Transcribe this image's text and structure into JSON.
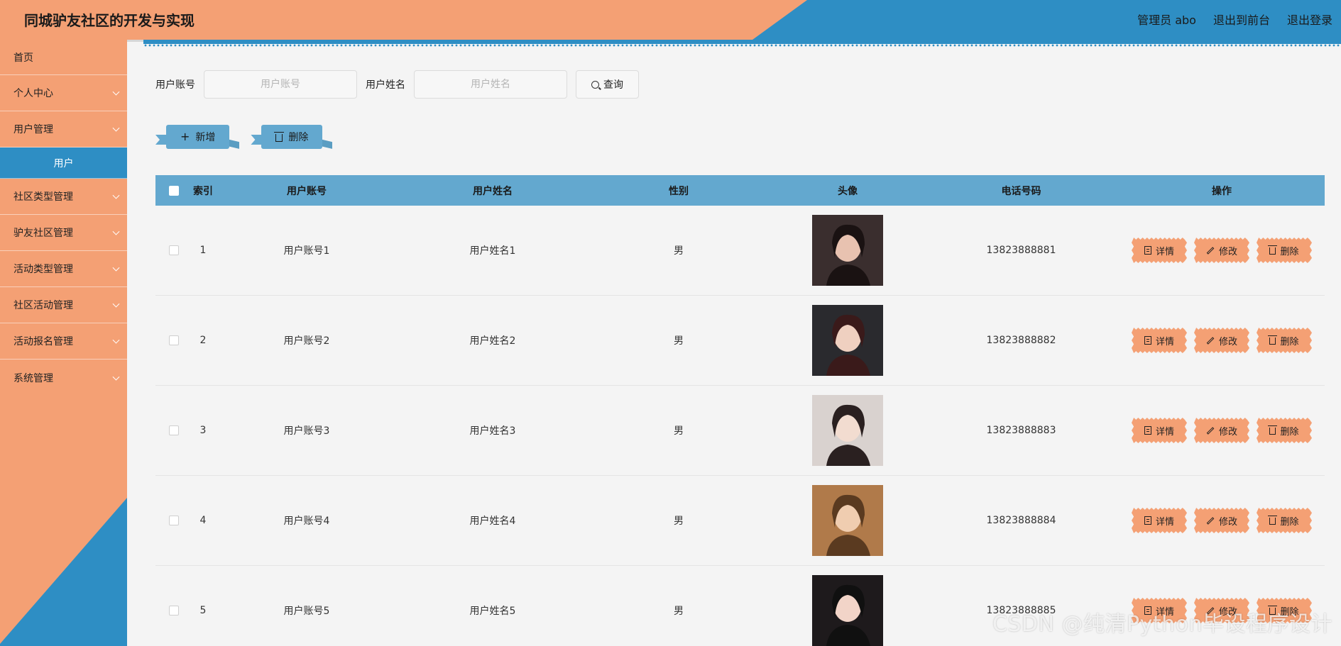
{
  "header": {
    "title": "同城驴友社区的开发与实现",
    "admin": "管理员 abo",
    "to_front": "退出到前台",
    "logout": "退出登录"
  },
  "sidebar": {
    "items": [
      {
        "label": "首页",
        "expandable": false
      },
      {
        "label": "个人中心",
        "expandable": true
      },
      {
        "label": "用户管理",
        "expandable": true
      },
      {
        "label": "社区类型管理",
        "expandable": true
      },
      {
        "label": "驴友社区管理",
        "expandable": true
      },
      {
        "label": "活动类型管理",
        "expandable": true
      },
      {
        "label": "社区活动管理",
        "expandable": true
      },
      {
        "label": "活动报名管理",
        "expandable": true
      },
      {
        "label": "系统管理",
        "expandable": true
      }
    ],
    "active_sub": "用户"
  },
  "search": {
    "account_label": "用户账号",
    "account_placeholder": "用户账号",
    "name_label": "用户姓名",
    "name_placeholder": "用户姓名",
    "query_label": "查询"
  },
  "actions": {
    "add_label": "新增",
    "delete_label": "删除"
  },
  "table": {
    "headers": [
      "索引",
      "用户账号",
      "用户姓名",
      "性别",
      "头像",
      "电话号码",
      "操作"
    ],
    "rows": [
      {
        "index": "1",
        "account": "用户账号1",
        "name": "用户姓名1",
        "sex": "男",
        "phone": "13823888881"
      },
      {
        "index": "2",
        "account": "用户账号2",
        "name": "用户姓名2",
        "sex": "男",
        "phone": "13823888882"
      },
      {
        "index": "3",
        "account": "用户账号3",
        "name": "用户姓名3",
        "sex": "男",
        "phone": "13823888883"
      },
      {
        "index": "4",
        "account": "用户账号4",
        "name": "用户姓名4",
        "sex": "男",
        "phone": "13823888884"
      },
      {
        "index": "5",
        "account": "用户账号5",
        "name": "用户姓名5",
        "sex": "男",
        "phone": "13823888885"
      }
    ],
    "op_labels": {
      "detail": "详情",
      "edit": "修改",
      "delete": "删除"
    }
  },
  "watermark": "CSDN @纯清Python毕设程序设计",
  "colors": {
    "accent_blue": "#2e8ec4",
    "peach": "#f4a074",
    "table_header": "#63a8cf"
  }
}
